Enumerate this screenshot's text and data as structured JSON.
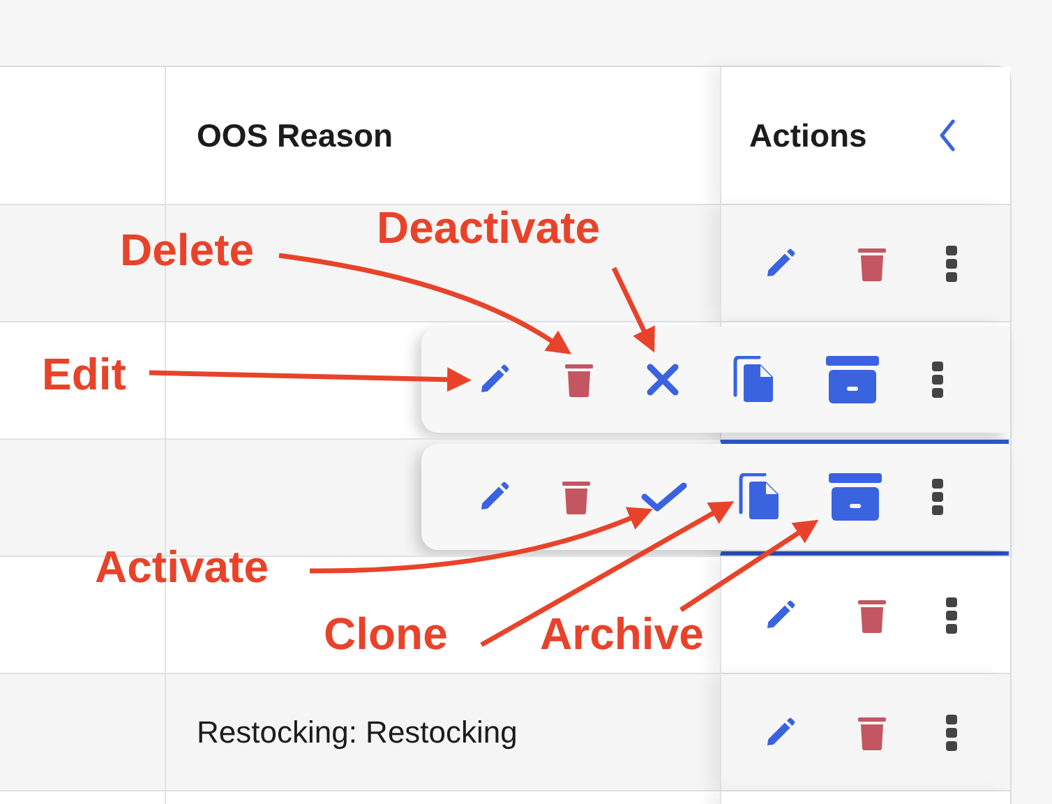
{
  "table": {
    "header": {
      "column_2": "OOS Reason",
      "actions": "Actions"
    },
    "rows": [
      {
        "expanded": false,
        "selected": false,
        "actions": [
          {
            "kind": "edit"
          },
          {
            "kind": "delete"
          },
          {
            "kind": "more"
          }
        ]
      },
      {
        "expanded": true,
        "selected": false,
        "actions": [
          {
            "kind": "edit"
          },
          {
            "kind": "delete"
          },
          {
            "kind": "deactivate"
          },
          {
            "kind": "clone"
          },
          {
            "kind": "archive"
          },
          {
            "kind": "more"
          }
        ]
      },
      {
        "expanded": true,
        "selected": true,
        "actions": [
          {
            "kind": "edit"
          },
          {
            "kind": "delete"
          },
          {
            "kind": "activate"
          },
          {
            "kind": "clone"
          },
          {
            "kind": "archive"
          },
          {
            "kind": "more"
          }
        ]
      },
      {
        "expanded": false,
        "selected": false,
        "actions": [
          {
            "kind": "edit"
          },
          {
            "kind": "delete"
          },
          {
            "kind": "more"
          }
        ]
      },
      {
        "expanded": false,
        "selected": false,
        "oos_reason": "Restocking: Restocking",
        "actions": [
          {
            "kind": "edit"
          },
          {
            "kind": "delete"
          },
          {
            "kind": "more"
          }
        ]
      }
    ]
  },
  "annotations": [
    {
      "text": "Delete"
    },
    {
      "text": "Deactivate"
    },
    {
      "text": "Edit"
    },
    {
      "text": "Activate"
    },
    {
      "text": "Clone"
    },
    {
      "text": "Archive"
    }
  ]
}
